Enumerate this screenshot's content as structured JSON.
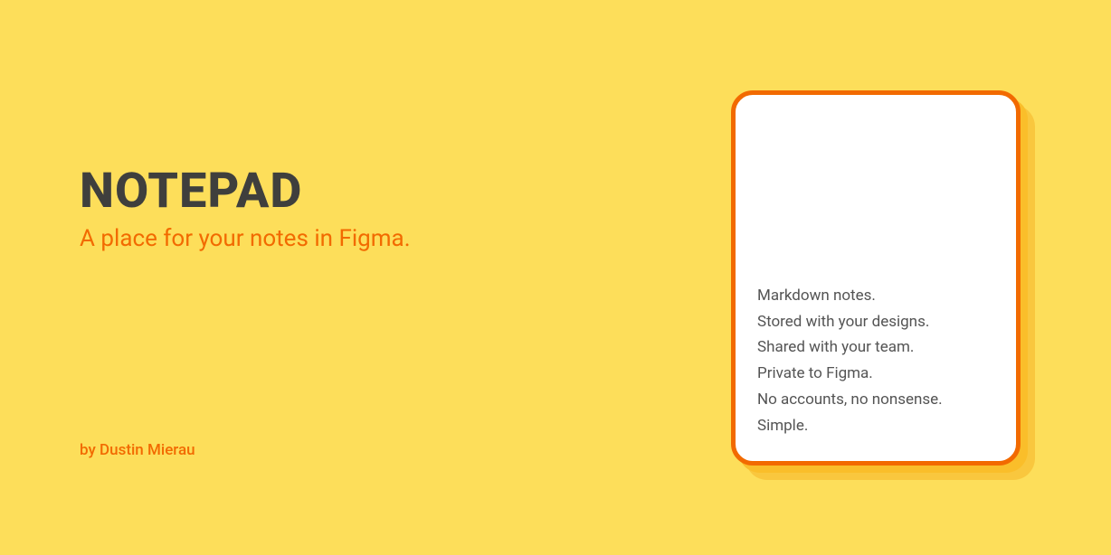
{
  "hero": {
    "title": "NOTEPAD",
    "subtitle": "A place for your notes in Figma.",
    "author": "by Dustin Mierau"
  },
  "card": {
    "lines": [
      "Markdown notes.",
      "Stored with your designs.",
      "Shared with your team.",
      "Private to Figma.",
      "No accounts, no nonsense.",
      "Simple."
    ]
  }
}
